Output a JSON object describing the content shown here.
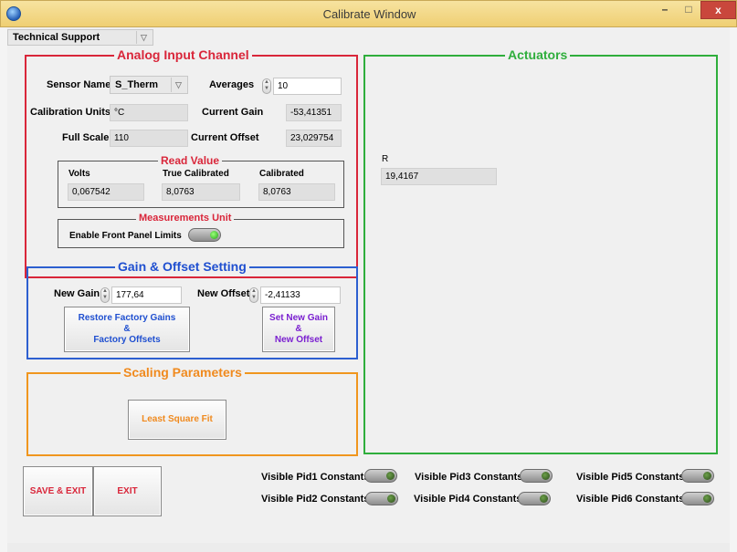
{
  "window": {
    "title": "Calibrate Window",
    "min_glyph": "–",
    "max_glyph": "□",
    "close_glyph": "x"
  },
  "header": {
    "dropdown_value": "Technical Support",
    "dropdown_arrow": "▽"
  },
  "analog": {
    "title": "Analog Input Channel",
    "sensor_name_label": "Sensor Name",
    "sensor_name_value": "S_Therm",
    "sensor_dropdown_arrow": "▽",
    "averages_label": "Averages",
    "averages_value": "10",
    "calibration_units_label": "Calibration Units",
    "calibration_units_value": "°C",
    "current_gain_label": "Current Gain",
    "current_gain_value": "-53,41351",
    "full_scale_label": "Full Scale",
    "full_scale_value": "110",
    "current_offset_label": "Current Offset",
    "current_offset_value": "23,029754",
    "read_value": {
      "title": "Read Value",
      "volts_label": "Volts",
      "volts_value": "0,067542",
      "true_calibrated_label": "True Calibrated",
      "true_calibrated_value": "8,0763",
      "calibrated_label": "Calibrated",
      "calibrated_value": "8,0763"
    },
    "measurements_unit": {
      "title": "Measurements Unit",
      "enable_label": "Enable Front Panel Limits",
      "enabled": true
    }
  },
  "gain_offset": {
    "title": "Gain & Offset Setting",
    "new_gain_label": "New Gain",
    "new_gain_value": "177,64",
    "new_offset_label": "New Offset",
    "new_offset_value": "-2,41133",
    "restore_button": [
      "Restore Factory Gains",
      "&",
      "Factory Offsets"
    ],
    "set_button": [
      "Set New Gain",
      "&",
      "New Offset"
    ]
  },
  "scaling": {
    "title": "Scaling Parameters",
    "least_square_label": "Least Square Fit"
  },
  "actuators": {
    "title": "Actuators",
    "r_label": "R",
    "r_value": "19,4167"
  },
  "buttons": {
    "save_exit": "SAVE & EXIT",
    "exit": "EXIT"
  },
  "pid_toggles": [
    {
      "label": "Visible Pid1 Constants"
    },
    {
      "label": "Visible Pid2 Constants"
    },
    {
      "label": "Visible Pid3 Constants"
    },
    {
      "label": "Visible Pid4 Constants"
    },
    {
      "label": "Visible Pid5 Constants"
    },
    {
      "label": "Visible Pid6 Constants"
    }
  ],
  "colors": {
    "analog_border": "#d9263a",
    "gain_border": "#2d5fd0",
    "scaling_border": "#f0961e",
    "actuators_border": "#2fae3c",
    "red_text": "#d9263a",
    "blue_text": "#1f4fd0",
    "orange_text": "#f08a1e",
    "green_text": "#2fae3c",
    "purple_text": "#7a1fd0"
  }
}
